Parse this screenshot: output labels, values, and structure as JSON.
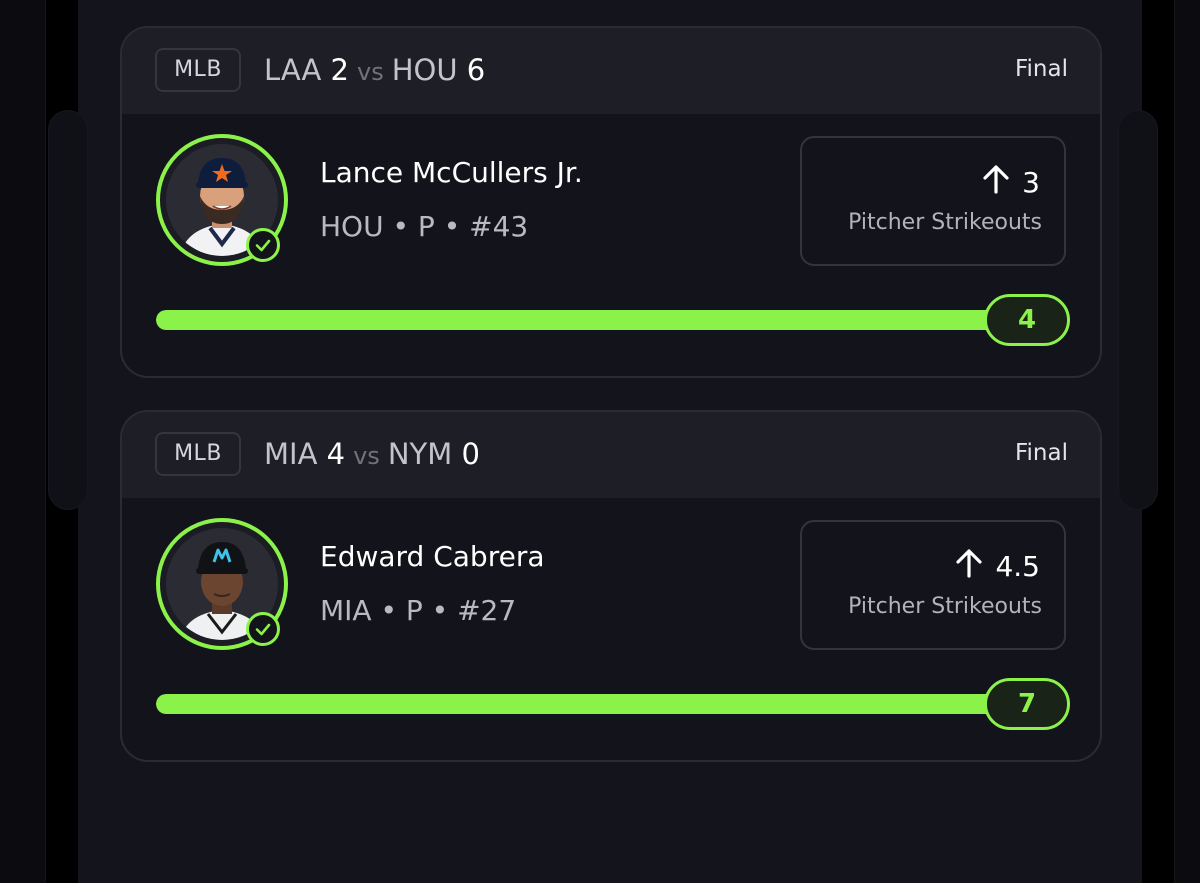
{
  "colors": {
    "accent_green": "#8bf24a",
    "card_bg": "#13141b",
    "header_bg": "#1d1e26",
    "sheet_bg": "#13141c"
  },
  "cards": [
    {
      "league": "MLB",
      "away_team": "LAA",
      "away_score": "2",
      "vs": "vs",
      "home_team": "HOU",
      "home_score": "6",
      "status": "Final",
      "player_name": "Lance McCullers Jr.",
      "player_meta": "HOU • P • #43",
      "prop_direction_icon": "arrow-up-icon",
      "prop_line": "3",
      "prop_type": "Pitcher Strikeouts",
      "progress": 1.0,
      "result": "4"
    },
    {
      "league": "MLB",
      "away_team": "MIA",
      "away_score": "4",
      "vs": "vs",
      "home_team": "NYM",
      "home_score": "0",
      "status": "Final",
      "player_name": "Edward Cabrera",
      "player_meta": "MIA • P • #27",
      "prop_direction_icon": "arrow-up-icon",
      "prop_line": "4.5",
      "prop_type": "Pitcher Strikeouts",
      "progress": 1.0,
      "result": "7"
    }
  ]
}
